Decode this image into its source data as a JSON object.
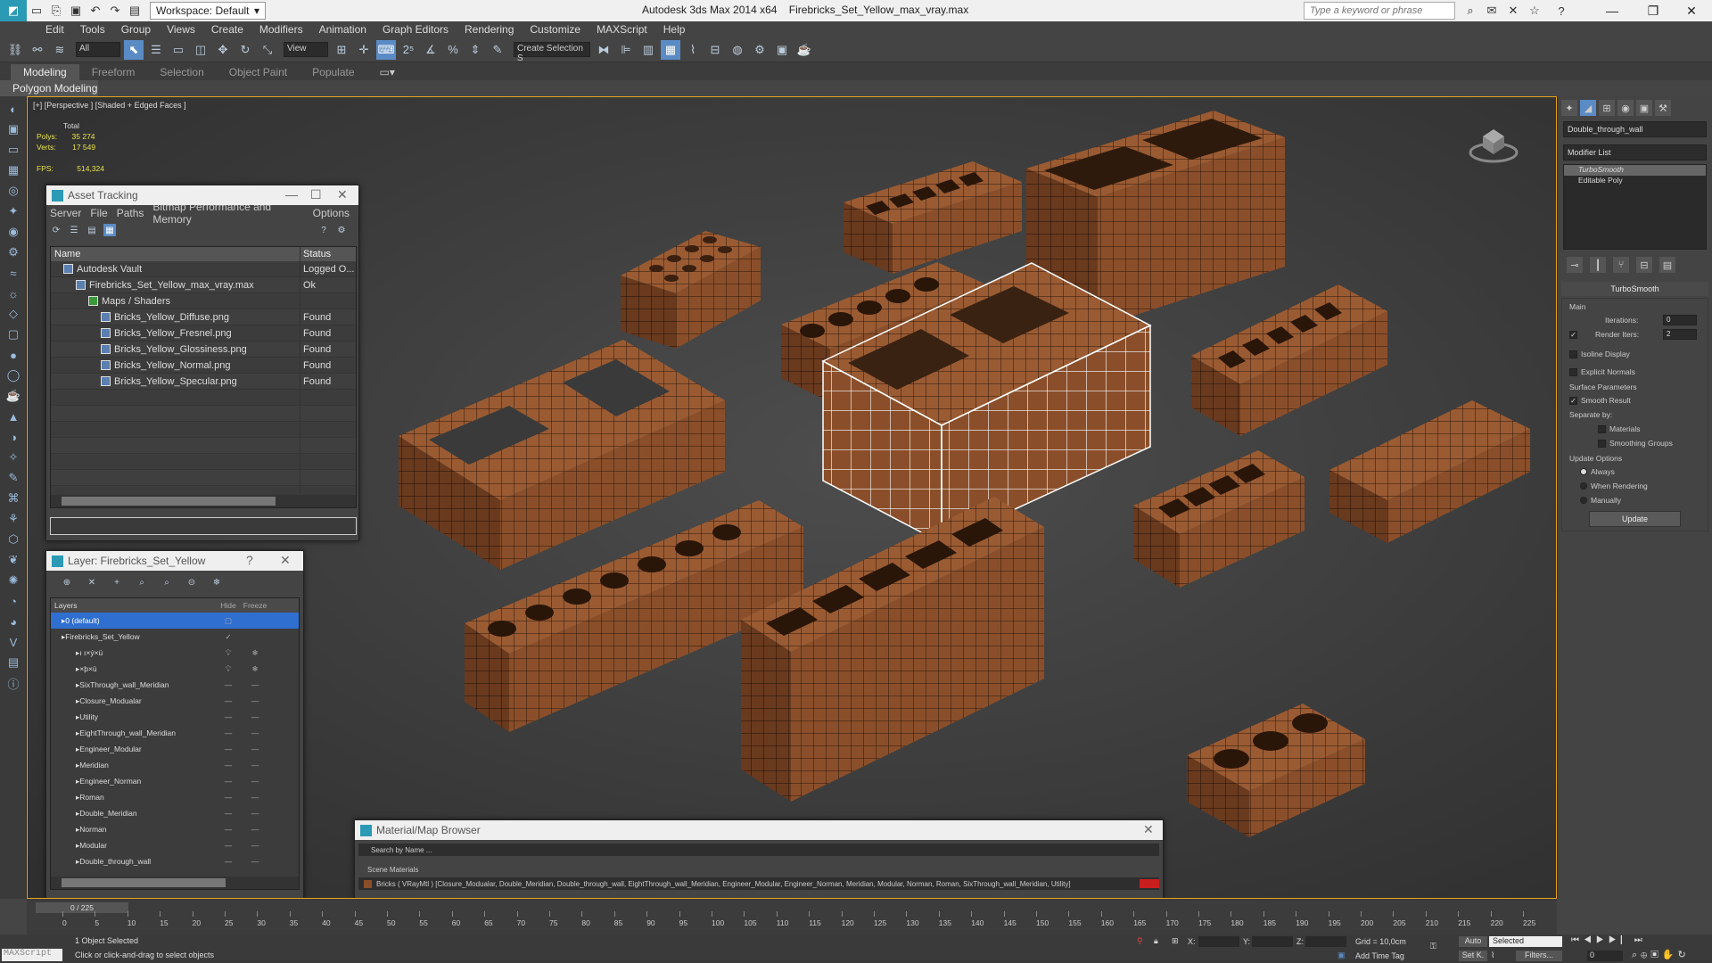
{
  "titlebar": {
    "workspace": "Workspace: Default",
    "app_title": "Autodesk 3ds Max  2014 x64",
    "file_title": "Firebricks_Set_Yellow_max_vray.max",
    "search_placeholder": "Type a keyword or phrase"
  },
  "menu": [
    "Edit",
    "Tools",
    "Group",
    "Views",
    "Create",
    "Modifiers",
    "Animation",
    "Graph Editors",
    "Rendering",
    "Customize",
    "MAXScript",
    "Help"
  ],
  "toolbar": {
    "filter": "All",
    "refcoord": "View",
    "selset": "Create Selection S"
  },
  "ribbon": {
    "tabs": [
      "Modeling",
      "Freeform",
      "Selection",
      "Object Paint",
      "Populate"
    ],
    "active": "Modeling",
    "subtitle": "Polygon Modeling"
  },
  "viewport": {
    "label": "[+] [Perspective ] [Shaded + Edged Faces ]",
    "stats": {
      "total_label": "Total",
      "polys_label": "Polys:",
      "polys": "35 274",
      "verts_label": "Verts:",
      "verts": "17 549",
      "fps_label": "FPS:",
      "fps": "514,324"
    }
  },
  "asset_tracking": {
    "title": "Asset Tracking",
    "menu": [
      "Server",
      "File",
      "Paths",
      "Bitmap Performance and Memory",
      "Options"
    ],
    "col_name": "Name",
    "col_status": "Status",
    "rows": [
      {
        "name": "Autodesk Vault",
        "status": "Logged O..."
      },
      {
        "name": "Firebricks_Set_Yellow_max_vray.max",
        "status": "Ok"
      },
      {
        "name": "Maps / Shaders",
        "status": ""
      },
      {
        "name": "Bricks_Yellow_Diffuse.png",
        "status": "Found"
      },
      {
        "name": "Bricks_Yellow_Fresnel.png",
        "status": "Found"
      },
      {
        "name": "Bricks_Yellow_Glossiness.png",
        "status": "Found"
      },
      {
        "name": "Bricks_Yellow_Normal.png",
        "status": "Found"
      },
      {
        "name": "Bricks_Yellow_Specular.png",
        "status": "Found"
      }
    ]
  },
  "layer_dialog": {
    "title": "Layer: Firebricks_Set_Yellow",
    "help": "?",
    "col_layers": "Layers",
    "col_hide": "Hide",
    "col_freeze": "Freeze",
    "rows": [
      {
        "name": "0 (default)",
        "level": 0
      },
      {
        "name": "Firebricks_Set_Yellow",
        "level": 0
      },
      {
        "name": "ı ı×ý×ü",
        "level": 1
      },
      {
        "name": "×þ×ü",
        "level": 1
      },
      {
        "name": "SixThrough_wall_Meridian",
        "level": 1
      },
      {
        "name": "Closure_Modualar",
        "level": 1
      },
      {
        "name": "Utility",
        "level": 1
      },
      {
        "name": "EightThrough_wall_Meridian",
        "level": 1
      },
      {
        "name": "Engineer_Modular",
        "level": 1
      },
      {
        "name": "Meridian",
        "level": 1
      },
      {
        "name": "Engineer_Norman",
        "level": 1
      },
      {
        "name": "Roman",
        "level": 1
      },
      {
        "name": "Double_Meridian",
        "level": 1
      },
      {
        "name": "Norman",
        "level": 1
      },
      {
        "name": "Modular",
        "level": 1
      },
      {
        "name": "Double_through_wall",
        "level": 1
      }
    ]
  },
  "material_browser": {
    "title": "Material/Map Browser",
    "search": "Search by Name ...",
    "section": "Scene Materials",
    "item": "Bricks ( VRayMtl ) [Closure_Modualar, Double_Meridian, Double_through_wall, EightThrough_wall_Meridian, Engineer_Modular, Engineer_Norman, Meridian, Modular, Norman, Roman, SixThrough_wall_Meridian, Utility]"
  },
  "command_panel": {
    "object_name": "Double_through_wall",
    "modifier_list": "Modifier List",
    "stack": [
      "TurboSmooth",
      "Editable Poly"
    ],
    "rollout_title": "TurboSmooth",
    "main_label": "Main",
    "iterations_label": "Iterations:",
    "iterations": "0",
    "render_iters_label": "Render Iters:",
    "render_iters": "2",
    "isoline": "Isoline Display",
    "explicit": "Explicit Normals",
    "surface_label": "Surface Parameters",
    "smooth_result": "Smooth Result",
    "separate_by": "Separate by:",
    "materials": "Materials",
    "smoothing_groups": "Smoothing Groups",
    "update_options": "Update Options",
    "always": "Always",
    "when_rendering": "When Rendering",
    "manually": "Manually",
    "update_btn": "Update"
  },
  "timeline": {
    "frame": "0 / 225",
    "ticks": [
      "0",
      "5",
      "10",
      "15",
      "20",
      "25",
      "30",
      "35",
      "40",
      "45",
      "50",
      "55",
      "60",
      "65",
      "70",
      "75",
      "80",
      "85",
      "90",
      "95",
      "100",
      "105",
      "110",
      "115",
      "120",
      "125",
      "130",
      "135",
      "140",
      "145",
      "150",
      "155",
      "160",
      "165",
      "170",
      "175",
      "180",
      "185",
      "190",
      "195",
      "200",
      "205",
      "210",
      "215",
      "220",
      "225"
    ]
  },
  "status": {
    "maxscript": "MAXScript",
    "selected": "1 Object Selected",
    "prompt": "Click or click-and-drag to select objects",
    "x_label": "X:",
    "y_label": "Y:",
    "z_label": "Z:",
    "grid": "Grid = 10,0cm",
    "auto": "Auto",
    "selected_dd": "Selected",
    "setk": "Set K.",
    "filters": "Filters...",
    "add_time_tag": "Add Time Tag",
    "frame": "0"
  },
  "colors": {
    "accent": "#5a8bc4",
    "viewport_border": "#e6a31e",
    "brick": "#8a4f2a",
    "selection": "#ffffff"
  }
}
